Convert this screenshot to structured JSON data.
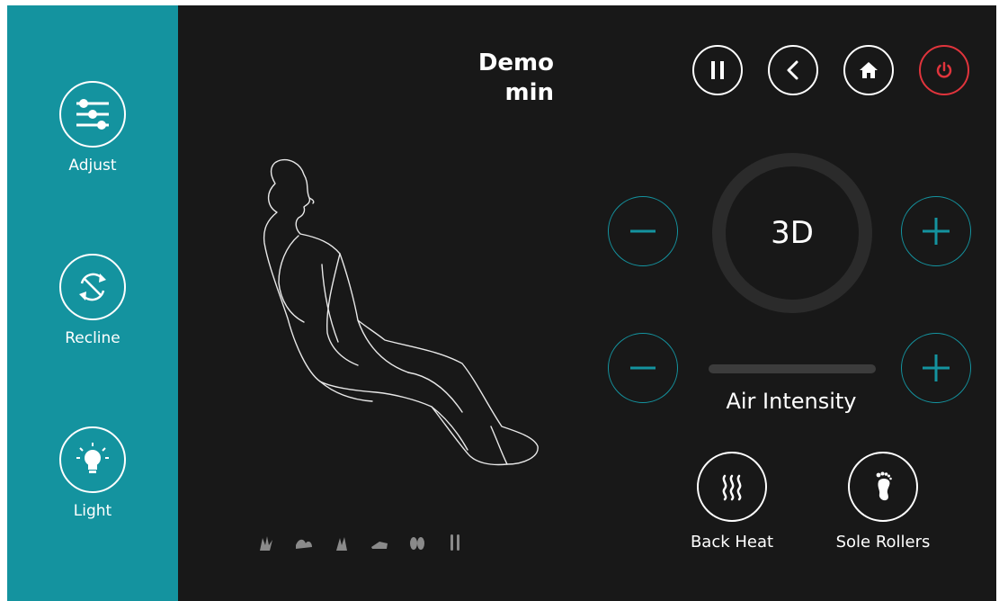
{
  "sidebar": {
    "items": [
      {
        "label": "Adjust",
        "icon": "sliders-icon"
      },
      {
        "label": "Recline",
        "icon": "recline-icon"
      },
      {
        "label": "Light",
        "icon": "lightbulb-icon"
      }
    ]
  },
  "header": {
    "title_line1": "Demo",
    "title_line2": "min"
  },
  "controls": {
    "mode_label": "3D",
    "air_label": "Air Intensity",
    "air_level": 0
  },
  "features": {
    "back_heat_label": "Back Heat",
    "sole_rollers_label": "Sole Rollers"
  },
  "colors": {
    "sidebar": "#14939f",
    "background": "#181818",
    "accent": "#14939f",
    "power": "#e0343c"
  }
}
